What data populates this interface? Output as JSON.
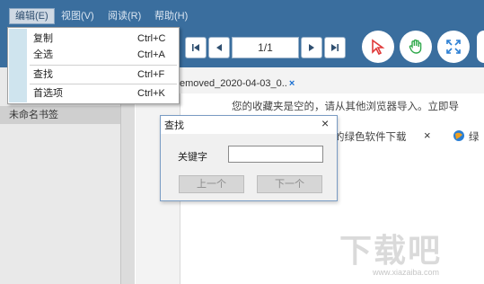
{
  "menubar": {
    "items": [
      {
        "label": "编辑(E)"
      },
      {
        "label": "视图(V)"
      },
      {
        "label": "阅读(R)"
      },
      {
        "label": "帮助(H)"
      }
    ]
  },
  "toolbar": {
    "page_indicator": "1/1",
    "icons": [
      "first-page-icon",
      "prev-page-icon",
      "next-page-icon",
      "last-page-icon",
      "select-arrow-icon",
      "hand-tool-icon",
      "fullscreen-icon"
    ]
  },
  "edit_menu": {
    "items": [
      {
        "label": "复制",
        "shortcut": "Ctrl+C"
      },
      {
        "label": "全选",
        "shortcut": "Ctrl+A"
      },
      {
        "label": "查找",
        "shortcut": "Ctrl+F"
      },
      {
        "label": "首选项",
        "shortcut": "Ctrl+K"
      }
    ]
  },
  "sidebar": {
    "bookmark_item": "未命名书签"
  },
  "document": {
    "tab_label": "emoved_2020-04-03_0..",
    "tab_close": "×",
    "line1": "您的收藏夹是空的，请从其他浏览器导入。立即导",
    "line2": "的绿色软件下载",
    "close_x": "×",
    "line2_suffix": "绿"
  },
  "find_dialog": {
    "title": "查找",
    "close": "×",
    "keyword_label": "关键字",
    "keyword_value": "",
    "prev_button": "上一个",
    "next_button": "下一个"
  },
  "watermark": {
    "text": "下载吧",
    "url": "www.xiazaiba.com"
  },
  "colors": {
    "menubar_bg": "#3a6e9e",
    "tool_red": "#e03a3a",
    "tool_green": "#2ea84a",
    "tool_blue": "#2b7fd4"
  }
}
